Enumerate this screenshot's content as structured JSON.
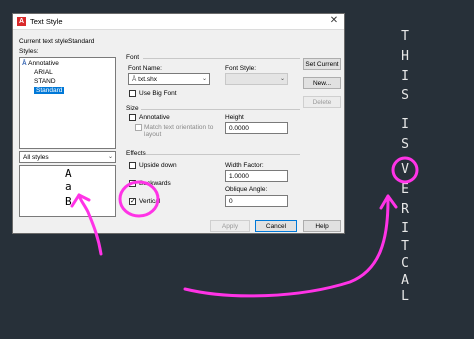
{
  "dialog": {
    "title": "Text Style",
    "current_style_label": "Current text style:",
    "current_style_value": "Standard",
    "styles_label": "Styles:",
    "styles": [
      "Annotative",
      "ARIAL",
      "STAND",
      "Standard"
    ],
    "selected_style": "Standard",
    "filter_value": "All styles",
    "preview_letters": [
      "A",
      "a",
      "B"
    ]
  },
  "font": {
    "section": "Font",
    "name_label": "Font Name:",
    "name_value": "txt.shx",
    "style_label": "Font Style:",
    "big_font_label": "Use Big Font"
  },
  "size": {
    "section": "Size",
    "annotative_label": "Annotative",
    "match_label_1": "Match text orientation to",
    "match_label_2": "layout",
    "height_label": "Height",
    "height_value": "0.0000"
  },
  "effects": {
    "section": "Effects",
    "upside_down_label": "Upside down",
    "backwards_label": "Backwards",
    "vertical_label": "Vertical",
    "vertical_checked": true,
    "width_factor_label": "Width Factor:",
    "width_factor_value": "1.0000",
    "oblique_label": "Oblique Angle:",
    "oblique_value": "0"
  },
  "buttons": {
    "set_current": "Set Current",
    "new": "New...",
    "delete": "Delete",
    "apply": "Apply",
    "cancel": "Cancel",
    "help": "Help"
  },
  "annotation": {
    "vertical_text": [
      "T",
      "H",
      "I",
      "S",
      "I",
      "S",
      "V",
      "E",
      "R",
      "I",
      "T",
      "C",
      "A",
      "L"
    ],
    "accent_color": "#ff33e6"
  }
}
